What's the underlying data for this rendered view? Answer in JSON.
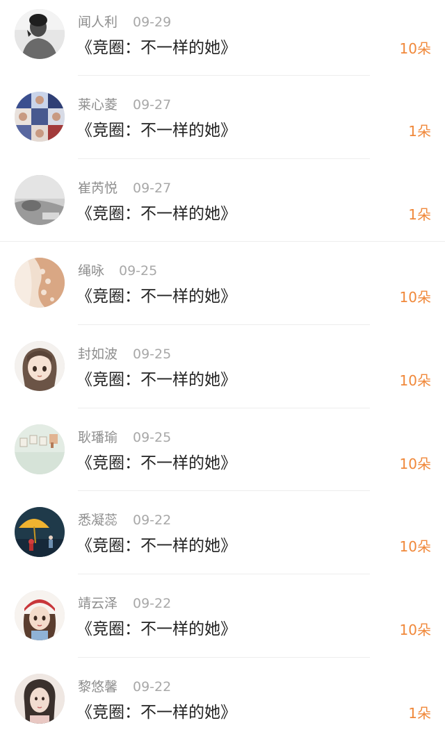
{
  "gift_list": {
    "accent_color": "#f0883a",
    "items": [
      {
        "name": "闻人利",
        "date": "09-29",
        "gift": "《竞圈：不一样的她》",
        "count": "10朵",
        "avatar_icon": "man-portrait-bw-avatar"
      },
      {
        "name": "莱心菱",
        "date": "09-27",
        "gift": "《竞圈：不一样的她》",
        "count": "1朵",
        "avatar_icon": "group-collage-avatar"
      },
      {
        "name": "崔芮悦",
        "date": "09-27",
        "gift": "《竞圈：不一样的她》",
        "count": "1朵",
        "avatar_icon": "gray-sketch-avatar"
      },
      {
        "name": "绳咏",
        "date": "09-25",
        "gift": "《竞圈：不一样的她》",
        "count": "10朵",
        "avatar_icon": "lace-fabric-avatar"
      },
      {
        "name": "封如波",
        "date": "09-25",
        "gift": "《竞圈：不一样的她》",
        "count": "10朵",
        "avatar_icon": "anime-girl-avatar"
      },
      {
        "name": "耿璠瑜",
        "date": "09-25",
        "gift": "《竞圈：不一样的她》",
        "count": "10朵",
        "avatar_icon": "letters-still-life-avatar"
      },
      {
        "name": "悉凝蕊",
        "date": "09-22",
        "gift": "《竞圈：不一样的她》",
        "count": "10朵",
        "avatar_icon": "umbrella-scene-avatar"
      },
      {
        "name": "靖云泽",
        "date": "09-22",
        "gift": "《竞圈：不一样的她》",
        "count": "10朵",
        "avatar_icon": "cartoon-girl-red-hat-avatar"
      },
      {
        "name": "黎悠馨",
        "date": "09-22",
        "gift": "《竞圈：不一样的她》",
        "count": "1朵",
        "avatar_icon": "woman-portrait-avatar"
      }
    ]
  }
}
